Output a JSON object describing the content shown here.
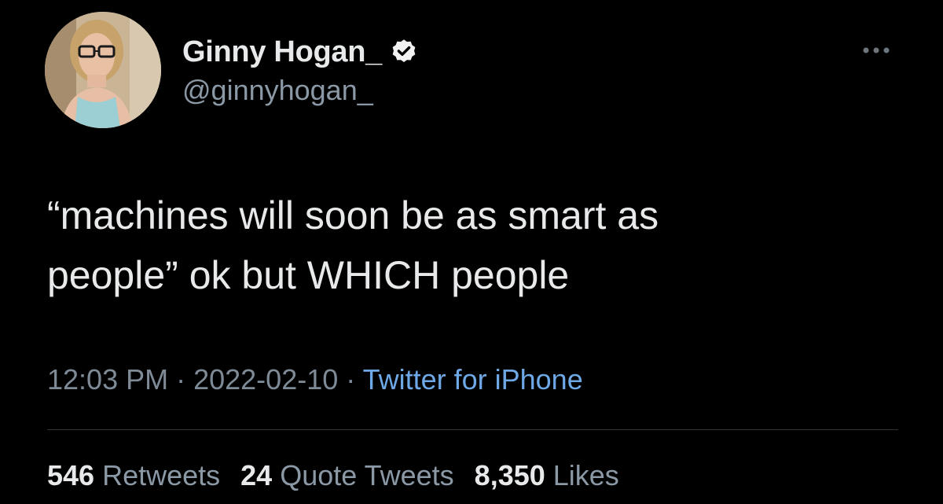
{
  "author": {
    "display_name": "Ginny Hogan_",
    "handle": "@ginnyhogan_",
    "verified_icon": "verified-badge-icon",
    "avatar": "profile-photo"
  },
  "tweet": {
    "text": "“machines will soon be as smart as\npeople” ok but WHICH people",
    "time": "12:03 PM",
    "separator": " · ",
    "date": "2022-02-10",
    "source": "Twitter for iPhone"
  },
  "stats": {
    "retweets_count": "546",
    "retweets_label": "Retweets",
    "quote_tweets_count": "24",
    "quote_tweets_label": "Quote Tweets",
    "likes_count": "8,350",
    "likes_label": "Likes"
  },
  "icons": {
    "more": "more-options-icon"
  },
  "colors": {
    "background": "#000000",
    "text": "#e7e9ea",
    "secondary_text": "#8b98a5",
    "link": "#6fa8e6",
    "divider": "#2f3336"
  }
}
